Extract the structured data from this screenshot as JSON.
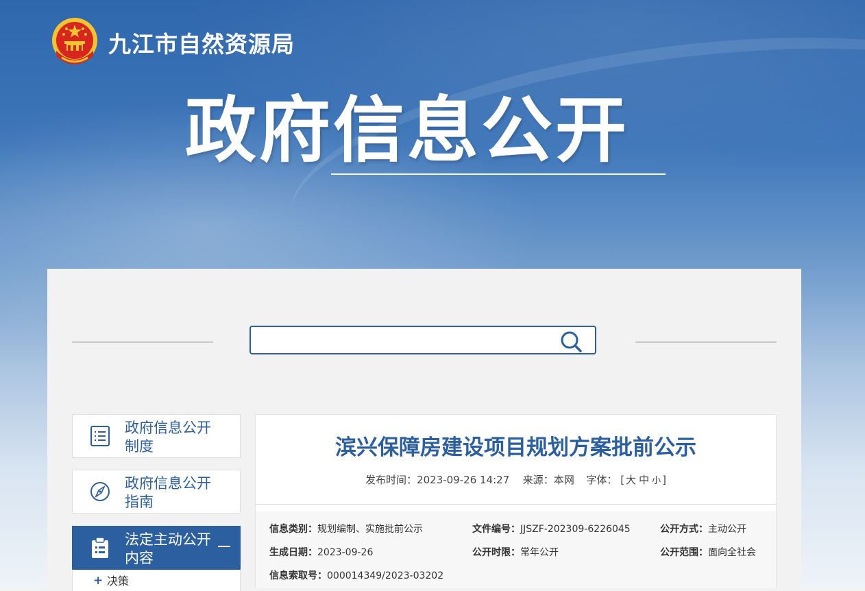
{
  "header": {
    "site_name": "九江市自然资源局",
    "hero_title": "政府信息公开"
  },
  "search": {
    "value": "",
    "placeholder": ""
  },
  "sidebar": {
    "items": [
      {
        "label": "政府信息公开制度",
        "icon": "list-document-icon",
        "active": false
      },
      {
        "label": "政府信息公开指南",
        "icon": "compass-icon",
        "active": false
      },
      {
        "label": "法定主动公开内容",
        "icon": "clipboard-icon",
        "active": true,
        "expanded": true
      }
    ],
    "sub_items": [
      {
        "label": "决策",
        "prefix": "+"
      }
    ]
  },
  "article": {
    "title": "滨兴保障房建设项目规划方案批前公示",
    "publish_label": "发布时间：",
    "publish_time": "2023-09-26 14:27",
    "source_label": "来源：",
    "source": "本网",
    "font_label": "字体：",
    "font_open": "[",
    "font_large": "大",
    "font_medium": "中",
    "font_small": "小",
    "font_close": "]"
  },
  "info": {
    "category_label": "信息类别：",
    "category": "规划编制、实施批前公示",
    "doc_no_label": "文件编号：",
    "doc_no": "JJSZF-202309-6226045",
    "open_method_label": "公开方式：",
    "open_method": "主动公开",
    "created_label": "生成日期：",
    "created": "2023-09-26",
    "open_period_label": "公开时限：",
    "open_period": "常年公开",
    "open_scope_label": "公开范围：",
    "open_scope": "面向全社会",
    "index_label": "信息索取号：",
    "index_no": "000014349/2023-03202"
  },
  "colors": {
    "primary": "#2c5f9f",
    "panel_bg": "#f2f2f2",
    "banner_top": "#2f67ad",
    "emblem_red": "#d7261e",
    "emblem_gold": "#f5c531"
  }
}
